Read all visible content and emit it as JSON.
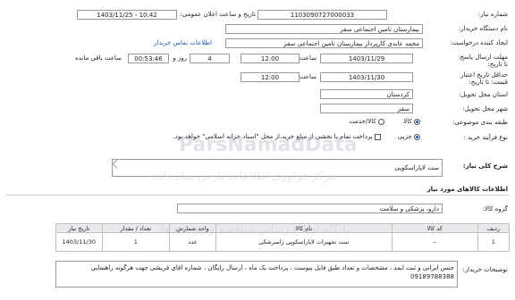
{
  "need_number": {
    "label": "شماره نیاز:",
    "value": "1103090727000033"
  },
  "announce_date": {
    "label": "تاریخ و ساعت اعلان عمومی:",
    "value": "1403/11/25 - 10:42"
  },
  "buyer_org": {
    "label": "نام دستگاه خریدار:",
    "value": "بیمارستان تامین اجتماعی سقز"
  },
  "requester": {
    "label": "ایجاد کننده درخواست:",
    "value": "محمد عابدی کارپرداز بیمارستان تامین اجتماعی سقز",
    "contact_link": "اطلاعات تماس خریدار"
  },
  "reply_deadline": {
    "label": "مهلت ارسال پاسخ: تا تاریخ:",
    "date": "1403/11/29",
    "time_label": "ساعت",
    "time": "12:00",
    "days": "4",
    "days_label": "روز و",
    "remaining": "00:53:46",
    "remaining_label": "ساعت باقی مانده"
  },
  "price_validity": {
    "label": "حداقل تاریخ اعتبار قیمت: تا تاریخ:",
    "date": "1403/11/30",
    "time_label": "ساعت",
    "time": "12:00"
  },
  "province": {
    "label": "استان محل تحویل:",
    "value": "کردستان"
  },
  "city": {
    "label": "شهر محل تحویل:",
    "value": "سقز"
  },
  "classification": {
    "label": "طبقه بندی موضوعی:",
    "options": [
      "کالا",
      "کالا/خدمت"
    ],
    "selected": "کالا"
  },
  "purchase_process": {
    "label": "نوع فرآیند خرید :",
    "option": "جزیی",
    "note": "پرداخت تمام یا بخشی از مبلغ خرید،از محل \"اسناد خزانه اسلامی\" خواهد بود."
  },
  "general_description": {
    "label": "شرح کلی نیاز:",
    "value": "ست لاپاراسکوپی"
  },
  "goods_section": {
    "title": "اطلاعات کالاهای مورد نیاز"
  },
  "goods_group": {
    "label": "گروه کالا:",
    "value": "دارو، پزشکی و سلامت"
  },
  "table": {
    "headers": [
      "ردیف",
      "کد کالا",
      "نام کالا",
      "واحد شمارش",
      "تعداد / مقدار",
      "تاریخ نیاز"
    ],
    "rows": [
      [
        "1",
        "--",
        "ست تجهیزات لاپاراسکوپی ژامبرشکی",
        "عدد",
        "1",
        "1403/11/30"
      ]
    ]
  },
  "buyer_notes": {
    "label": "توضیحات خریدار:",
    "value": "جنس ایرانی و ثبت ایمد ، مشخصات و تعداد طبق فایل پیوست ، پرداخت یک ماه ، ارسال رایگان ، شماره اقای قریشی جهت هرگونه راهنمایی 09189788388"
  },
  "watermark": {
    "brand": "ParsNamadData",
    "tagline": "مرکز فراوری اطلاعات پارس نماد داده",
    "sub": "پایگاه اطلاع رسانی مناقصه و مزایده ها"
  },
  "colors": {
    "link": "#1a57a8",
    "border": "#9a9a9a",
    "header_bg": "#e8eaed"
  }
}
